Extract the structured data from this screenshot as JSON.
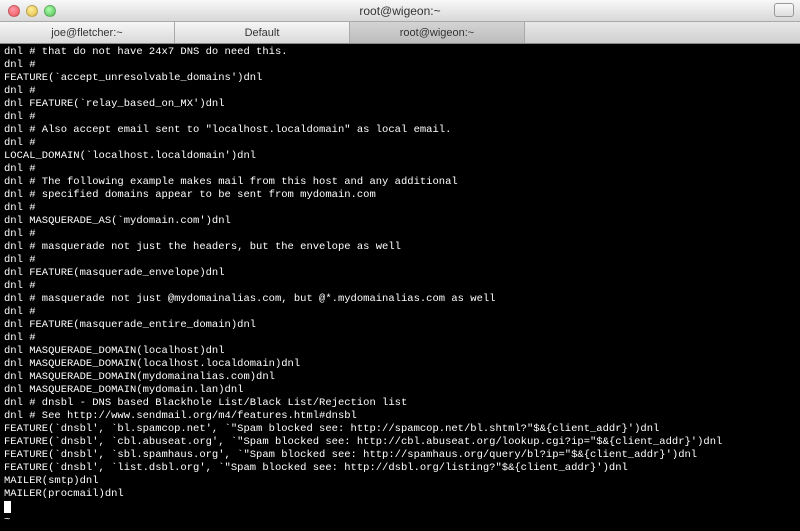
{
  "window": {
    "title": "root@wigeon:~"
  },
  "tabs": [
    {
      "label": "joe@fletcher:~",
      "active": false
    },
    {
      "label": "Default",
      "active": false
    },
    {
      "label": "root@wigeon:~",
      "active": true
    }
  ],
  "terminal": {
    "lines": [
      "dnl # that do not have 24x7 DNS do need this.",
      "dnl #",
      "FEATURE(`accept_unresolvable_domains')dnl",
      "dnl #",
      "dnl FEATURE(`relay_based_on_MX')dnl",
      "dnl #",
      "dnl # Also accept email sent to \"localhost.localdomain\" as local email.",
      "dnl #",
      "LOCAL_DOMAIN(`localhost.localdomain')dnl",
      "dnl #",
      "dnl # The following example makes mail from this host and any additional",
      "dnl # specified domains appear to be sent from mydomain.com",
      "dnl #",
      "dnl MASQUERADE_AS(`mydomain.com')dnl",
      "dnl #",
      "dnl # masquerade not just the headers, but the envelope as well",
      "dnl #",
      "dnl FEATURE(masquerade_envelope)dnl",
      "dnl #",
      "dnl # masquerade not just @mydomainalias.com, but @*.mydomainalias.com as well",
      "dnl #",
      "dnl FEATURE(masquerade_entire_domain)dnl",
      "dnl #",
      "dnl MASQUERADE_DOMAIN(localhost)dnl",
      "dnl MASQUERADE_DOMAIN(localhost.localdomain)dnl",
      "dnl MASQUERADE_DOMAIN(mydomainalias.com)dnl",
      "dnl MASQUERADE_DOMAIN(mydomain.lan)dnl",
      "dnl # dnsbl - DNS based Blackhole List/Black List/Rejection list",
      "dnl # See http://www.sendmail.org/m4/features.html#dnsbl",
      "FEATURE(`dnsbl', `bl.spamcop.net', `\"Spam blocked see: http://spamcop.net/bl.shtml?\"$&{client_addr}')dnl",
      "FEATURE(`dnsbl', `cbl.abuseat.org', `\"Spam blocked see: http://cbl.abuseat.org/lookup.cgi?ip=\"$&{client_addr}')dnl",
      "FEATURE(`dnsbl', `sbl.spamhaus.org', `\"Spam blocked see: http://spamhaus.org/query/bl?ip=\"$&{client_addr}')dnl",
      "FEATURE(`dnsbl', `list.dsbl.org', `\"Spam blocked see: http://dsbl.org/listing?\"$&{client_addr}')dnl",
      "MAILER(smtp)dnl",
      "MAILER(procmail)dnl"
    ],
    "trailing_tilde": "~"
  }
}
